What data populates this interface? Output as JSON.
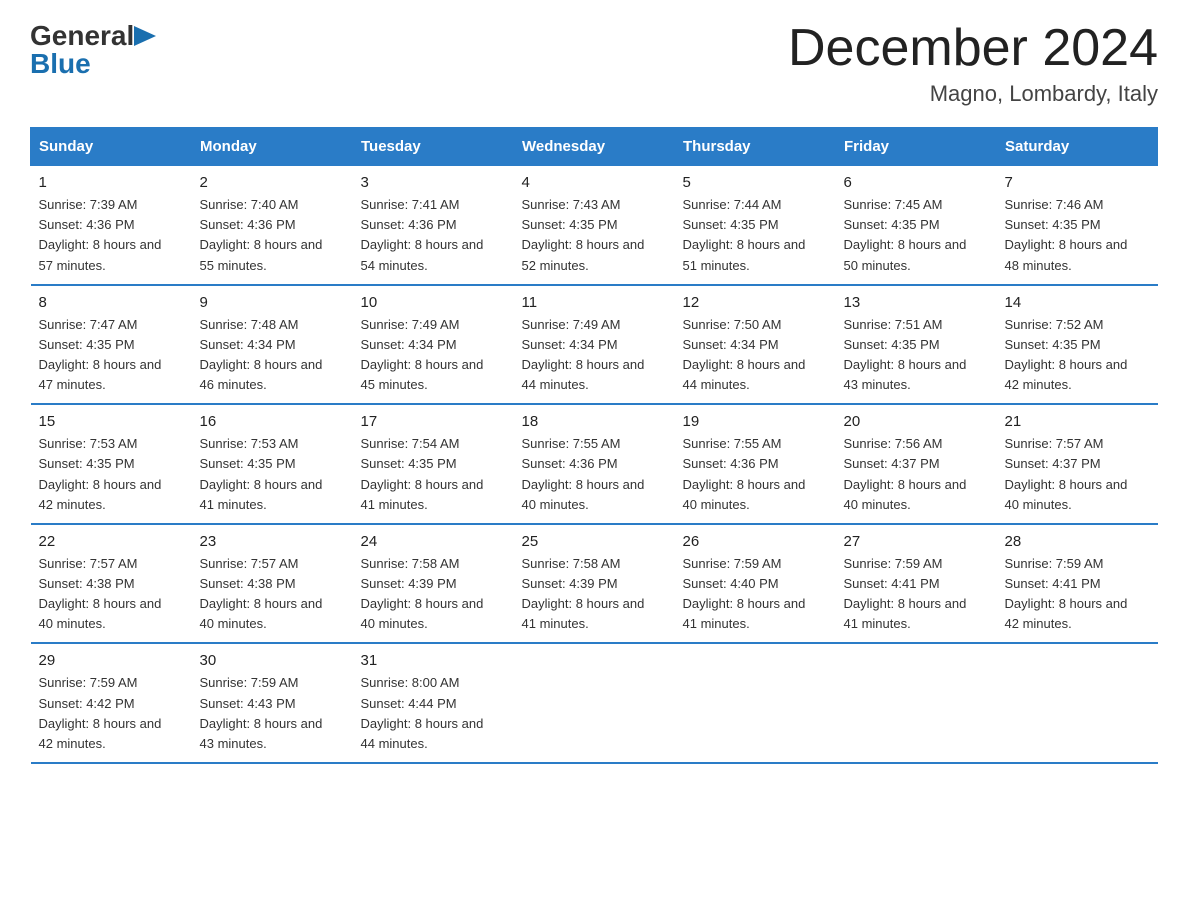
{
  "logo": {
    "general": "General",
    "blue": "Blue"
  },
  "title": "December 2024",
  "location": "Magno, Lombardy, Italy",
  "weekdays": [
    "Sunday",
    "Monday",
    "Tuesday",
    "Wednesday",
    "Thursday",
    "Friday",
    "Saturday"
  ],
  "weeks": [
    [
      {
        "day": "1",
        "sunrise": "7:39 AM",
        "sunset": "4:36 PM",
        "daylight": "8 hours and 57 minutes."
      },
      {
        "day": "2",
        "sunrise": "7:40 AM",
        "sunset": "4:36 PM",
        "daylight": "8 hours and 55 minutes."
      },
      {
        "day": "3",
        "sunrise": "7:41 AM",
        "sunset": "4:36 PM",
        "daylight": "8 hours and 54 minutes."
      },
      {
        "day": "4",
        "sunrise": "7:43 AM",
        "sunset": "4:35 PM",
        "daylight": "8 hours and 52 minutes."
      },
      {
        "day": "5",
        "sunrise": "7:44 AM",
        "sunset": "4:35 PM",
        "daylight": "8 hours and 51 minutes."
      },
      {
        "day": "6",
        "sunrise": "7:45 AM",
        "sunset": "4:35 PM",
        "daylight": "8 hours and 50 minutes."
      },
      {
        "day": "7",
        "sunrise": "7:46 AM",
        "sunset": "4:35 PM",
        "daylight": "8 hours and 48 minutes."
      }
    ],
    [
      {
        "day": "8",
        "sunrise": "7:47 AM",
        "sunset": "4:35 PM",
        "daylight": "8 hours and 47 minutes."
      },
      {
        "day": "9",
        "sunrise": "7:48 AM",
        "sunset": "4:34 PM",
        "daylight": "8 hours and 46 minutes."
      },
      {
        "day": "10",
        "sunrise": "7:49 AM",
        "sunset": "4:34 PM",
        "daylight": "8 hours and 45 minutes."
      },
      {
        "day": "11",
        "sunrise": "7:49 AM",
        "sunset": "4:34 PM",
        "daylight": "8 hours and 44 minutes."
      },
      {
        "day": "12",
        "sunrise": "7:50 AM",
        "sunset": "4:34 PM",
        "daylight": "8 hours and 44 minutes."
      },
      {
        "day": "13",
        "sunrise": "7:51 AM",
        "sunset": "4:35 PM",
        "daylight": "8 hours and 43 minutes."
      },
      {
        "day": "14",
        "sunrise": "7:52 AM",
        "sunset": "4:35 PM",
        "daylight": "8 hours and 42 minutes."
      }
    ],
    [
      {
        "day": "15",
        "sunrise": "7:53 AM",
        "sunset": "4:35 PM",
        "daylight": "8 hours and 42 minutes."
      },
      {
        "day": "16",
        "sunrise": "7:53 AM",
        "sunset": "4:35 PM",
        "daylight": "8 hours and 41 minutes."
      },
      {
        "day": "17",
        "sunrise": "7:54 AM",
        "sunset": "4:35 PM",
        "daylight": "8 hours and 41 minutes."
      },
      {
        "day": "18",
        "sunrise": "7:55 AM",
        "sunset": "4:36 PM",
        "daylight": "8 hours and 40 minutes."
      },
      {
        "day": "19",
        "sunrise": "7:55 AM",
        "sunset": "4:36 PM",
        "daylight": "8 hours and 40 minutes."
      },
      {
        "day": "20",
        "sunrise": "7:56 AM",
        "sunset": "4:37 PM",
        "daylight": "8 hours and 40 minutes."
      },
      {
        "day": "21",
        "sunrise": "7:57 AM",
        "sunset": "4:37 PM",
        "daylight": "8 hours and 40 minutes."
      }
    ],
    [
      {
        "day": "22",
        "sunrise": "7:57 AM",
        "sunset": "4:38 PM",
        "daylight": "8 hours and 40 minutes."
      },
      {
        "day": "23",
        "sunrise": "7:57 AM",
        "sunset": "4:38 PM",
        "daylight": "8 hours and 40 minutes."
      },
      {
        "day": "24",
        "sunrise": "7:58 AM",
        "sunset": "4:39 PM",
        "daylight": "8 hours and 40 minutes."
      },
      {
        "day": "25",
        "sunrise": "7:58 AM",
        "sunset": "4:39 PM",
        "daylight": "8 hours and 41 minutes."
      },
      {
        "day": "26",
        "sunrise": "7:59 AM",
        "sunset": "4:40 PM",
        "daylight": "8 hours and 41 minutes."
      },
      {
        "day": "27",
        "sunrise": "7:59 AM",
        "sunset": "4:41 PM",
        "daylight": "8 hours and 41 minutes."
      },
      {
        "day": "28",
        "sunrise": "7:59 AM",
        "sunset": "4:41 PM",
        "daylight": "8 hours and 42 minutes."
      }
    ],
    [
      {
        "day": "29",
        "sunrise": "7:59 AM",
        "sunset": "4:42 PM",
        "daylight": "8 hours and 42 minutes."
      },
      {
        "day": "30",
        "sunrise": "7:59 AM",
        "sunset": "4:43 PM",
        "daylight": "8 hours and 43 minutes."
      },
      {
        "day": "31",
        "sunrise": "8:00 AM",
        "sunset": "4:44 PM",
        "daylight": "8 hours and 44 minutes."
      },
      null,
      null,
      null,
      null
    ]
  ]
}
